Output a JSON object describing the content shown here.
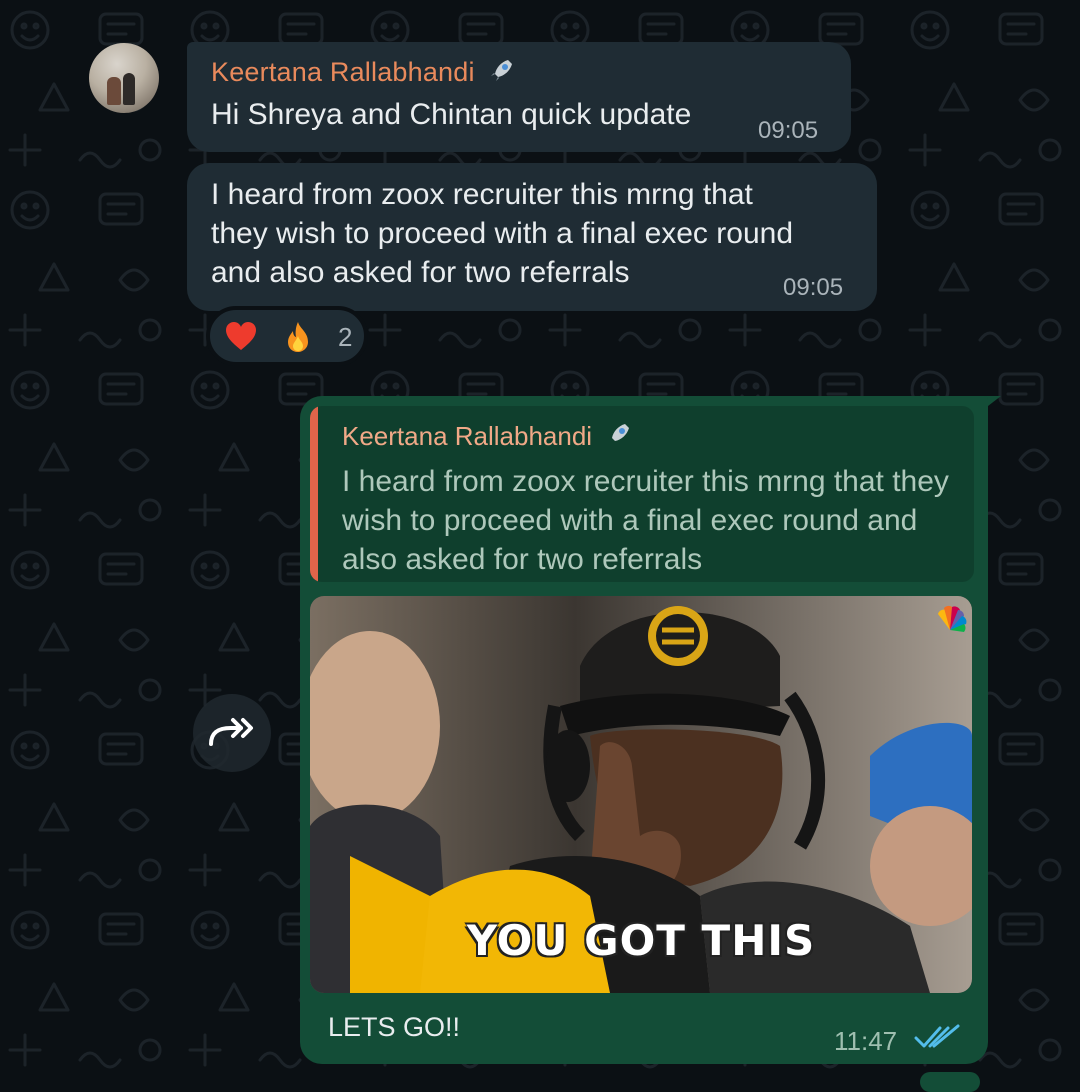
{
  "chat": {
    "messages_in": [
      {
        "sender": "Keertana Rallabhandi",
        "text": "Hi Shreya and Chintan quick update",
        "time": "09:05"
      },
      {
        "text": "I heard from zoox recruiter this mrng that\nthey wish to proceed with a final exec round\nand also asked for two referrals",
        "time": "09:05",
        "reactions": {
          "emojis": [
            "heart",
            "fire"
          ],
          "count": "2"
        }
      }
    ],
    "message_out": {
      "quote": {
        "sender": "Keertana Rallabhandi",
        "text": "I heard from zoox recruiter this mrng that they wish to proceed with a final exec round and also asked for two referrals"
      },
      "gif_caption": "YOU  GOT THIS",
      "text": "LETS GO!!",
      "time": "11:47",
      "status": "read"
    }
  },
  "icons": {
    "forward": "forward-icon",
    "read_receipt": "double-check-icon",
    "sender_badge": "rocket-icon"
  },
  "colors": {
    "background": "#0b1014",
    "incoming_bubble": "#1f2c34",
    "outgoing_bubble": "#134d37",
    "sender_name": "#e98a5c",
    "quote_bar": "#e0644a",
    "read_ticks": "#53bdeb"
  }
}
